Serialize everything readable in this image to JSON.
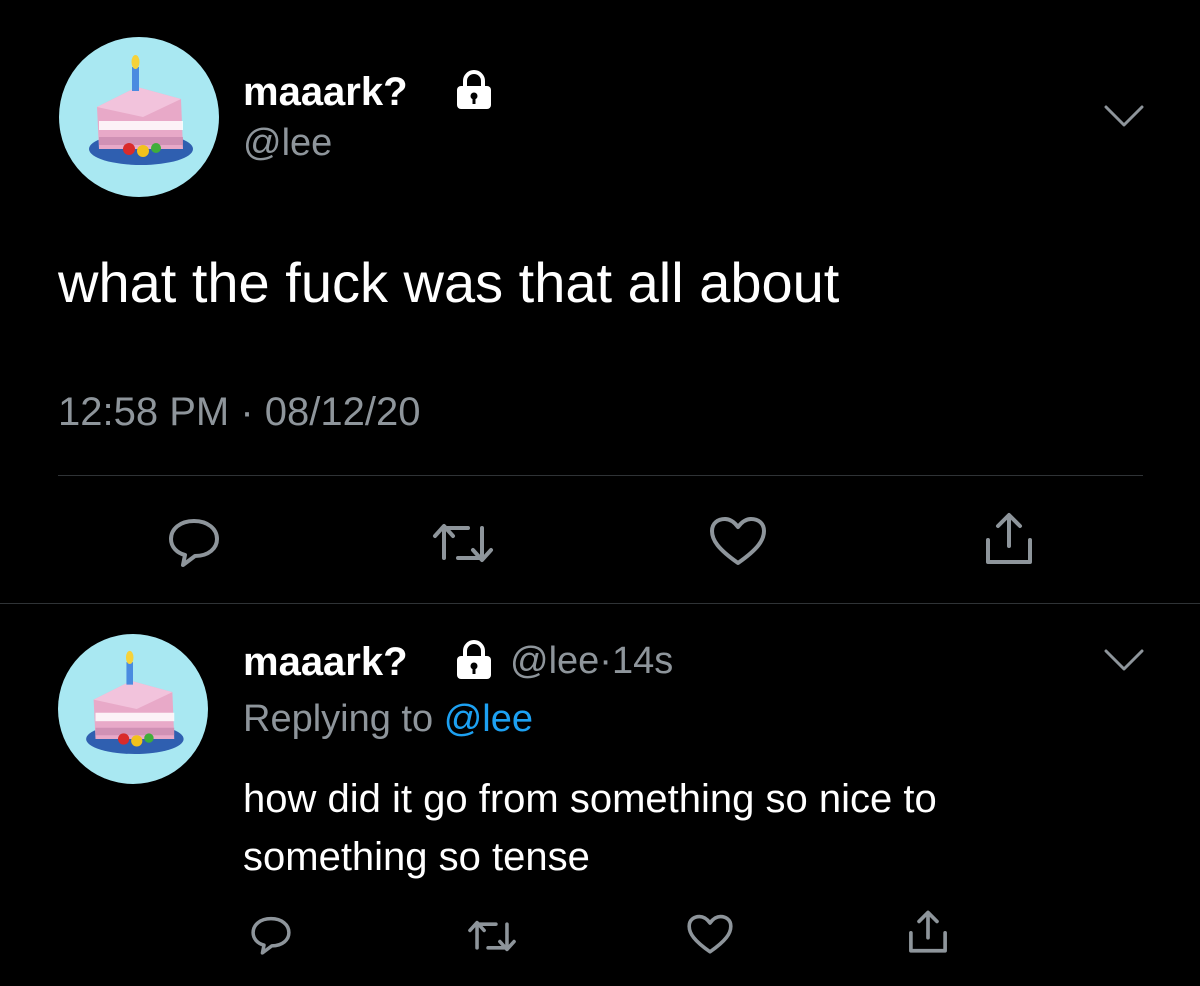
{
  "main_tweet": {
    "display_name": "maaark?",
    "handle": "@lee",
    "text": "what the fuck was that all about",
    "timestamp": "12:58 PM · 08/12/20",
    "avatar_icon": "birthday-cake-icon",
    "protected_icon": "lock-icon"
  },
  "reply_tweet": {
    "display_name": "maaark?",
    "handle": "@lee",
    "separator": "·",
    "age": "14s",
    "replying_prefix": "Replying to",
    "replying_to": "@lee",
    "text_line1": "how did it go from something so nice to",
    "text_line2": "something so tense",
    "avatar_icon": "birthday-cake-icon",
    "protected_icon": "lock-icon"
  },
  "actions": [
    "reply-icon",
    "retweet-icon",
    "like-icon",
    "share-icon"
  ],
  "colors": {
    "background": "#000000",
    "primary_text": "#ffffff",
    "secondary_text": "#8e959b",
    "mention": "#1da1f2",
    "avatar_bg": "#a9e8f2",
    "divider": "#2f3336"
  }
}
